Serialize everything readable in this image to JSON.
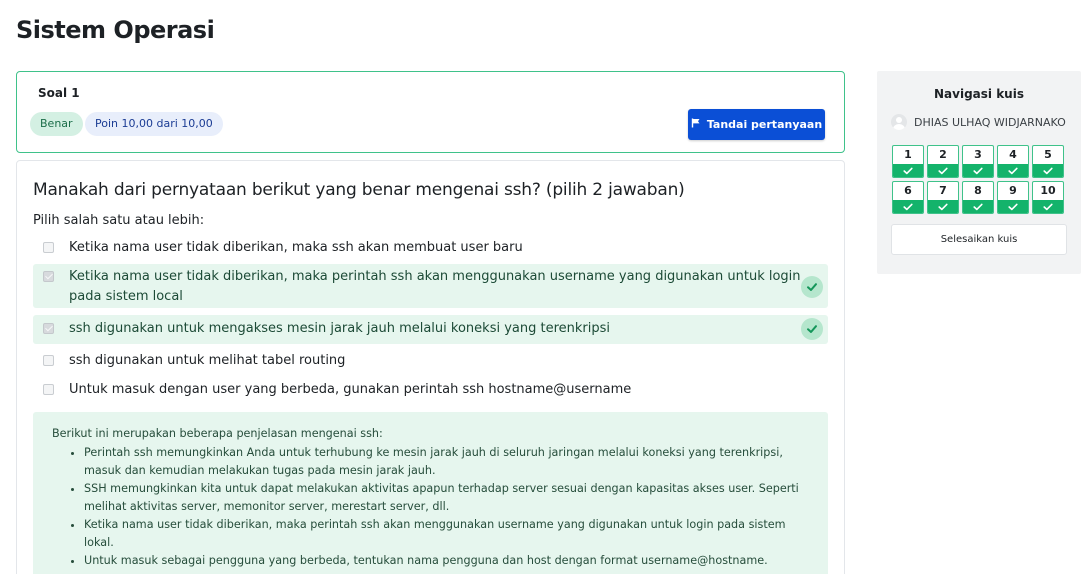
{
  "page": {
    "title": "Sistem Operasi"
  },
  "question_info": {
    "label": "Soal 1",
    "status_badge": "Benar",
    "points_badge": "Poin 10,00 dari 10,00",
    "flag_button": "Tandai pertanyaan"
  },
  "question": {
    "text": "Manakah dari pernyataan berikut yang benar mengenai ssh? (pilih 2 jawaban)",
    "prompt": "Pilih salah satu atau lebih:",
    "options": [
      {
        "text": "Ketika nama user tidak diberikan, maka ssh akan membuat user baru",
        "checked": false,
        "correct": false
      },
      {
        "text": "Ketika nama user tidak diberikan, maka perintah ssh akan menggunakan username yang digunakan untuk login pada sistem local",
        "checked": true,
        "correct": true
      },
      {
        "text": "ssh digunakan untuk mengakses mesin jarak jauh melalui koneksi yang terenkripsi",
        "checked": true,
        "correct": true
      },
      {
        "text": "ssh digunakan untuk melihat tabel routing",
        "checked": false,
        "correct": false
      },
      {
        "text": "Untuk masuk dengan user yang berbeda, gunakan perintah ssh hostname@username",
        "checked": false,
        "correct": false
      }
    ]
  },
  "feedback": {
    "intro": "Berikut ini merupakan beberapa penjelasan mengenai ssh:",
    "items": [
      " Perintah ssh memungkinkan Anda untuk terhubung ke mesin jarak jauh di seluruh jaringan melalui koneksi yang terenkripsi, masuk dan kemudian melakukan tugas pada mesin jarak jauh.",
      "SSH memungkinkan kita untuk dapat melakukan aktivitas apapun terhadap server sesuai dengan kapasitas akses user. Seperti melihat aktivitas server, memonitor server, merestart server, dll.",
      "Ketika nama user tidak diberikan, maka perintah ssh akan menggunakan username yang digunakan untuk login pada sistem lokal.",
      "Untuk masuk sebagai pengguna yang berbeda, tentukan nama pengguna dan host dengan format username@hostname."
    ]
  },
  "navigation": {
    "title": "Navigasi kuis",
    "user_name": "DHIAS ULHAQ WIDJARNAKO",
    "questions": [
      "1",
      "2",
      "3",
      "4",
      "5",
      "6",
      "7",
      "8",
      "9",
      "10"
    ],
    "finish_button": "Selesaikan kuis"
  },
  "colors": {
    "accent_blue": "#0b4fd6",
    "correct_green": "#14b36b",
    "correct_bg": "#e6f6ee"
  }
}
